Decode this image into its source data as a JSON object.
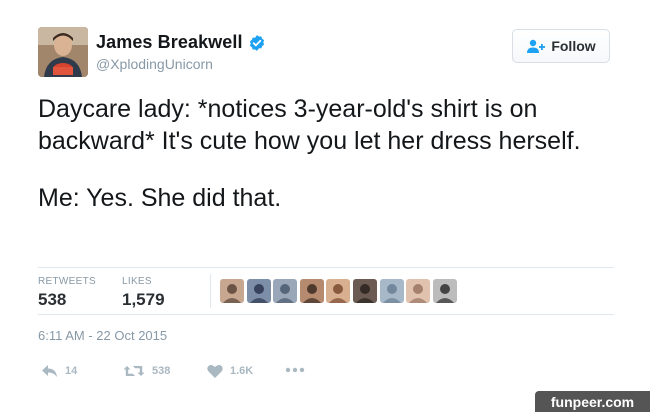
{
  "author": {
    "name": "James Breakwell",
    "handle": "@XplodingUnicorn",
    "verified": true
  },
  "follow_button": {
    "label": "Follow",
    "icon": "add-user-icon"
  },
  "tweet": {
    "paragraphs": [
      "Daycare lady: *notices 3-year-old's shirt is on backward* It's cute how you let her dress herself.",
      "Me: Yes. She did that."
    ]
  },
  "stats": {
    "retweets_label": "RETWEETS",
    "retweets_value": "538",
    "likes_label": "LIKES",
    "likes_value": "1,579",
    "liker_avatar_count": 9
  },
  "timestamp": "6:11 AM - 22 Oct 2015",
  "actions": {
    "reply_count": "14",
    "retweet_count": "538",
    "like_count": "1.6K"
  },
  "watermark": "funpeer.com",
  "colors": {
    "verified_blue": "#1da1f2",
    "meta_gray": "#8899a6",
    "divider": "#e1e8ed",
    "action_gray": "#aab8c2"
  }
}
